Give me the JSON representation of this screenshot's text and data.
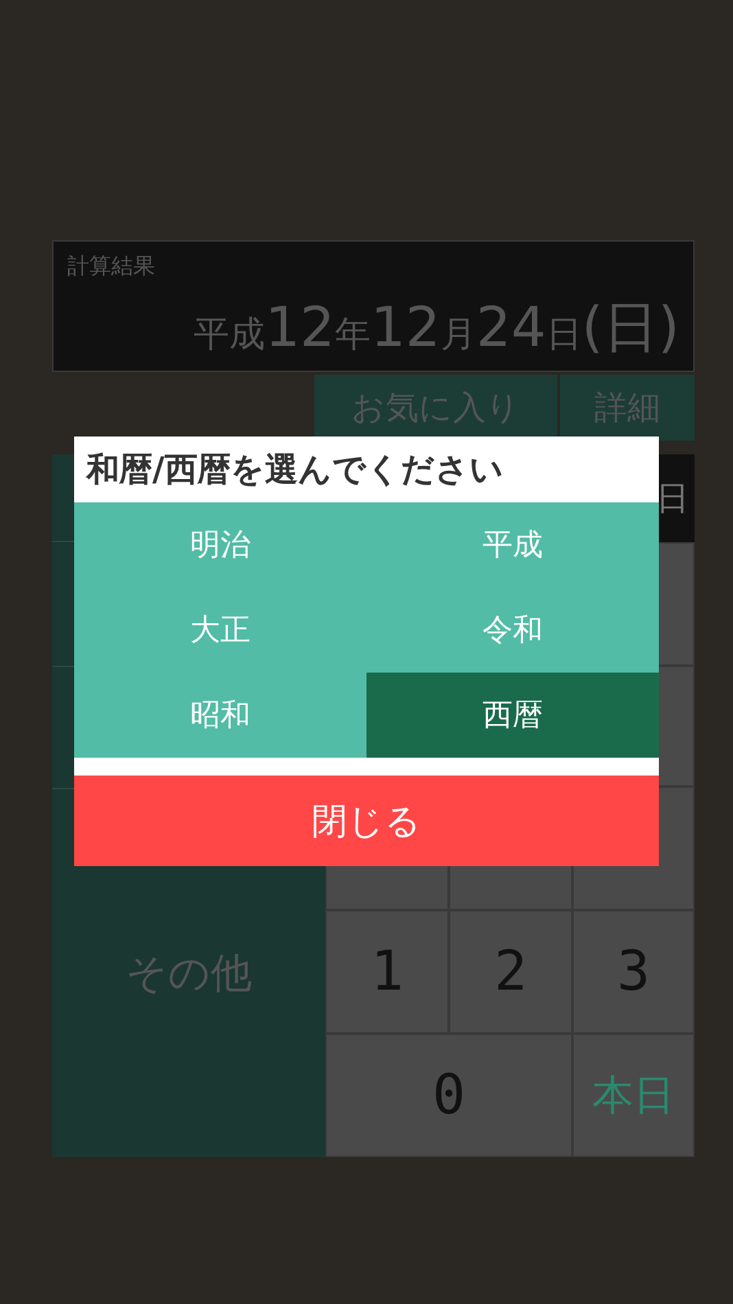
{
  "result": {
    "label": "計算結果",
    "date": [
      {
        "text": "平成",
        "kind": "unit"
      },
      {
        "text": "12",
        "kind": "number"
      },
      {
        "text": "年",
        "kind": "unit"
      },
      {
        "text": "12",
        "kind": "number"
      },
      {
        "text": "月",
        "kind": "unit"
      },
      {
        "text": "24",
        "kind": "number"
      },
      {
        "text": "日",
        "kind": "unit"
      },
      {
        "text": "(日)",
        "kind": "number"
      }
    ]
  },
  "actions": [
    "お気に入り",
    "詳細"
  ],
  "keypad": {
    "header_fragment": "日",
    "side_key": "その他",
    "keys": [
      {
        "label": "1",
        "kind": "digit"
      },
      {
        "label": "2",
        "kind": "digit"
      },
      {
        "label": "3",
        "kind": "digit"
      },
      {
        "label": "0",
        "kind": "digit"
      },
      {
        "label": "本日",
        "kind": "today"
      }
    ]
  },
  "dialog": {
    "title": "和暦/西暦を選んでください",
    "options": [
      {
        "label": "明治",
        "selected": false
      },
      {
        "label": "平成",
        "selected": false
      },
      {
        "label": "大正",
        "selected": false
      },
      {
        "label": "令和",
        "selected": false
      },
      {
        "label": "昭和",
        "selected": false
      },
      {
        "label": "西暦",
        "selected": true
      }
    ],
    "close": "閉じる"
  }
}
